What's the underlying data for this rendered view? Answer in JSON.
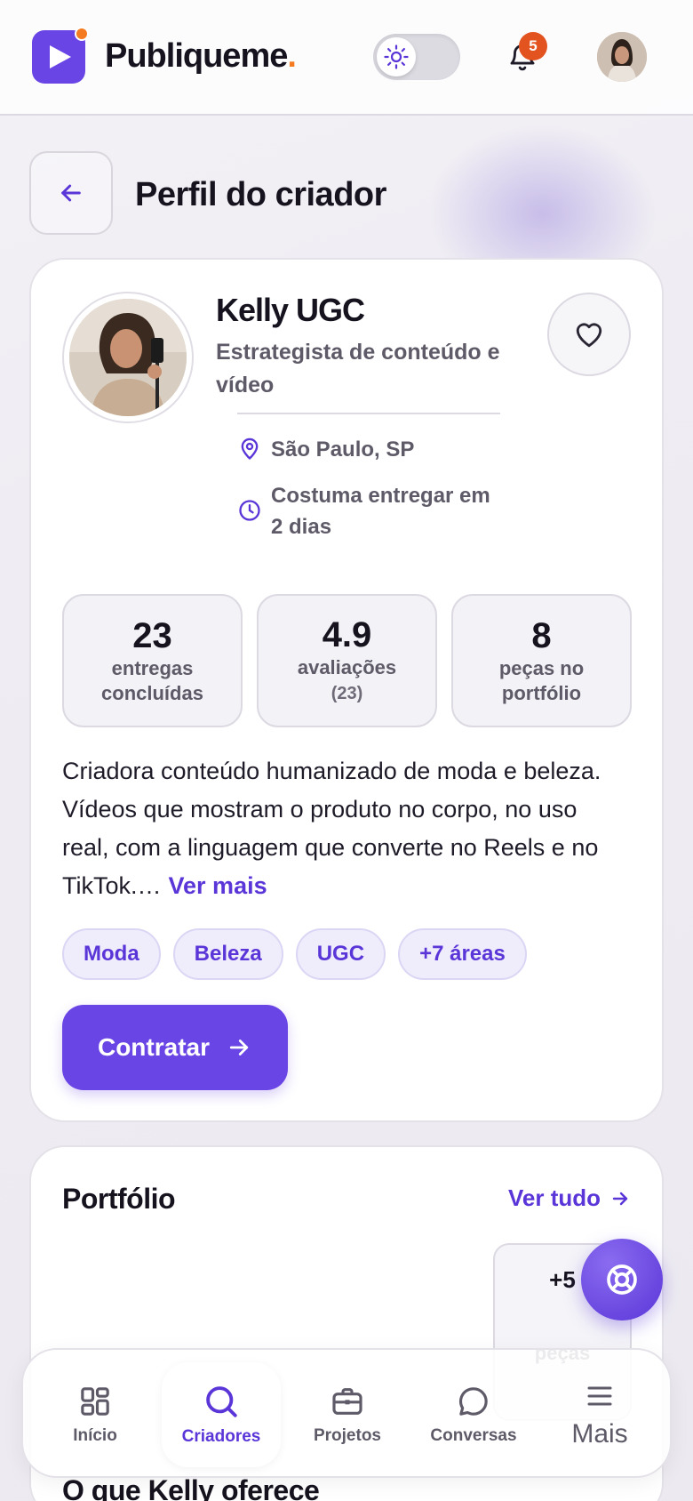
{
  "brand": {
    "name": "Publiqueme",
    "dot": ".",
    "accent": "#6a45e5",
    "dot_color": "#f47b20"
  },
  "header": {
    "theme_toggle_icon": "sun-icon",
    "notifications_count": "5",
    "avatar_icon": "user-avatar"
  },
  "page": {
    "title": "Perfil do criador",
    "back_icon": "arrow-left-icon"
  },
  "creator": {
    "name": "Kelly UGC",
    "role": "Estrategista de conteúdo e vídeo",
    "location": "São Paulo, SP",
    "delivery": "Costuma entregar em 2 dias",
    "favorite_icon": "heart-icon"
  },
  "stats": [
    {
      "value": "23",
      "label": "entregas concluídas",
      "sub": ""
    },
    {
      "value": "4.9",
      "label": "avaliações",
      "sub": "(23)"
    },
    {
      "value": "8",
      "label": "peças no portfólio",
      "sub": ""
    }
  ],
  "bio": {
    "text": "Criadora conteúdo humanizado de moda e beleza. Vídeos que mostram o produto no corpo, no uso real, com a linguagem que converte no Reels e no TikTok.…",
    "more_label": "Ver mais"
  },
  "tags": [
    "Moda",
    "Beleza",
    "UGC",
    "+7 áreas"
  ],
  "hire_button": {
    "label": "Contratar"
  },
  "portfolio": {
    "title": "Portfólio",
    "link_label": "Ver tudo",
    "extra_count": "+5",
    "extra_label": "peças"
  },
  "next_section": {
    "title": "O que Kelly oferece"
  },
  "nav": [
    {
      "label": "Início",
      "icon": "grid-icon",
      "active": false
    },
    {
      "label": "Criadores",
      "icon": "search-icon",
      "active": true
    },
    {
      "label": "Projetos",
      "icon": "briefcase-icon",
      "active": false
    },
    {
      "label": "Conversas",
      "icon": "chat-icon",
      "active": false
    },
    {
      "label": "Mais",
      "icon": "menu-icon",
      "active": false
    }
  ]
}
